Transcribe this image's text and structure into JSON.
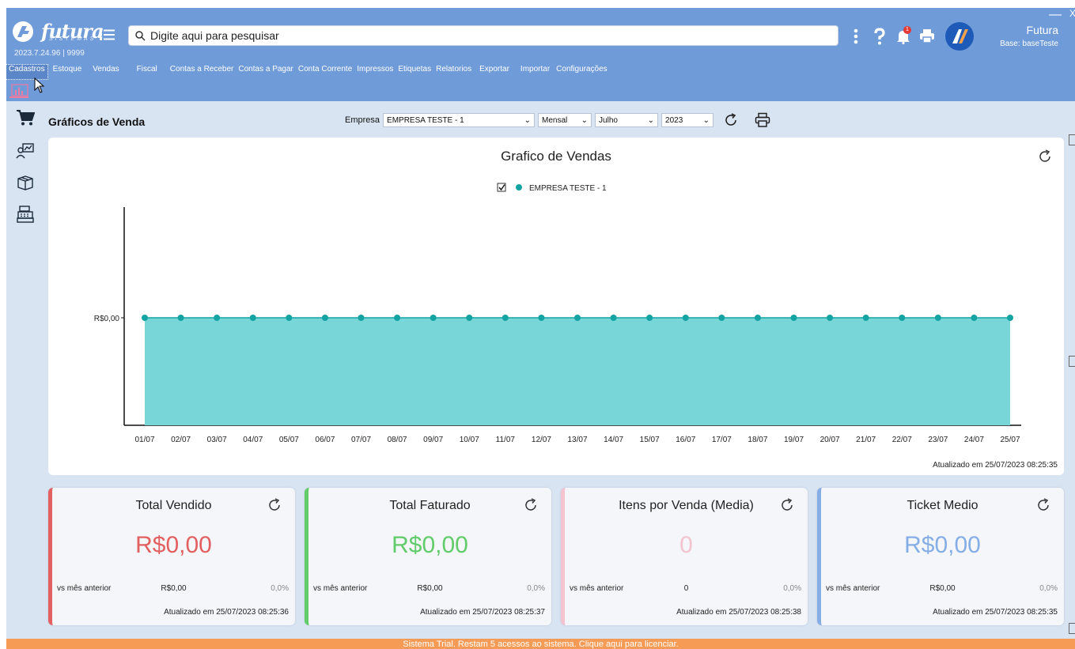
{
  "header": {
    "logo_text": "futura",
    "logo_sub": "SISTEMAS",
    "version": "2023.7.24.96 | 9999",
    "search_placeholder": "Digite aqui para pesquisar",
    "user_name": "Futura",
    "user_base": "Base: baseTeste",
    "notification_count": "1",
    "min_label": "—",
    "close_label": "X",
    "icons": [
      "kebab-menu-icon",
      "help-icon",
      "bell-icon",
      "print-icon",
      "brand-icon"
    ]
  },
  "nav": {
    "items": [
      "Cadastros",
      "Estoque",
      "Vendas",
      "Fiscal",
      "Contas a Receber",
      "Contas a Pagar",
      "Conta Corrente",
      "Impressos",
      "Etiquetas",
      "Relatorios",
      "Exportar",
      "Importar",
      "Configurações"
    ],
    "active_index": 0
  },
  "rail": {
    "icons": [
      "cart-icon",
      "people-chart-icon",
      "box-icon",
      "cash-register-icon"
    ]
  },
  "page": {
    "title": "Gráficos de Venda",
    "empresa_label": "Empresa",
    "empresa_value": "EMPRESA TESTE - 1",
    "periodo_value": "Mensal",
    "mes_value": "Julho",
    "ano_value": "2023"
  },
  "chart": {
    "title": "Grafico de Vendas",
    "legend_label": "EMPRESA TESTE - 1",
    "legend_checked": true,
    "updated": "Atualizado em 25/07/2023 08:25:35"
  },
  "chart_data": {
    "type": "area",
    "title": "Grafico de Vendas",
    "x": [
      "01/07",
      "02/07",
      "03/07",
      "04/07",
      "05/07",
      "06/07",
      "07/07",
      "08/07",
      "09/07",
      "10/07",
      "11/07",
      "12/07",
      "13/07",
      "14/07",
      "15/07",
      "16/07",
      "17/07",
      "18/07",
      "19/07",
      "20/07",
      "21/07",
      "22/07",
      "23/07",
      "24/07",
      "25/07"
    ],
    "series": [
      {
        "name": "EMPRESA TESTE - 1",
        "values": [
          0,
          0,
          0,
          0,
          0,
          0,
          0,
          0,
          0,
          0,
          0,
          0,
          0,
          0,
          0,
          0,
          0,
          0,
          0,
          0,
          0,
          0,
          0,
          0,
          0
        ],
        "color": "#14a3a3",
        "fill": "#79d6d8"
      }
    ],
    "y_ticks": [
      "R$0,00"
    ],
    "legend": "top-center",
    "grid": false
  },
  "kpis": [
    {
      "title": "Total Vendido",
      "value": "R$0,00",
      "vs": "vs mês anterior",
      "prev": "R$0,00",
      "pct": "0,0%",
      "updated": "Atualizado em 25/07/2023 08:25:36",
      "color": "#e36060"
    },
    {
      "title": "Total Faturado",
      "value": "R$0,00",
      "vs": "vs mês anterior",
      "prev": "R$0,00",
      "pct": "0,0%",
      "updated": "Atualizado em 25/07/2023 08:25:37",
      "color": "#62cc6a"
    },
    {
      "title": "Itens por Venda (Media)",
      "value": "0",
      "vs": "vs mês anterior",
      "prev": "0",
      "pct": "0,0%",
      "updated": "Atualizado em 25/07/2023 08:25:38",
      "color": "#f4c3d0"
    },
    {
      "title": "Ticket Medio",
      "value": "R$0,00",
      "vs": "vs mês anterior",
      "prev": "R$0,00",
      "pct": "0,0%",
      "updated": "Atualizado em 25/07/2023 08:25:35",
      "color": "#86aee6"
    }
  ],
  "footer": {
    "text": "Sistema Trial. Restam 5 acessos ao sistema. Clique aqui para licenciar."
  },
  "colors": {
    "header": "#6f9bd9",
    "background": "#d9e4f3",
    "footer": "#f59b55",
    "accent": "#14a3a3"
  }
}
